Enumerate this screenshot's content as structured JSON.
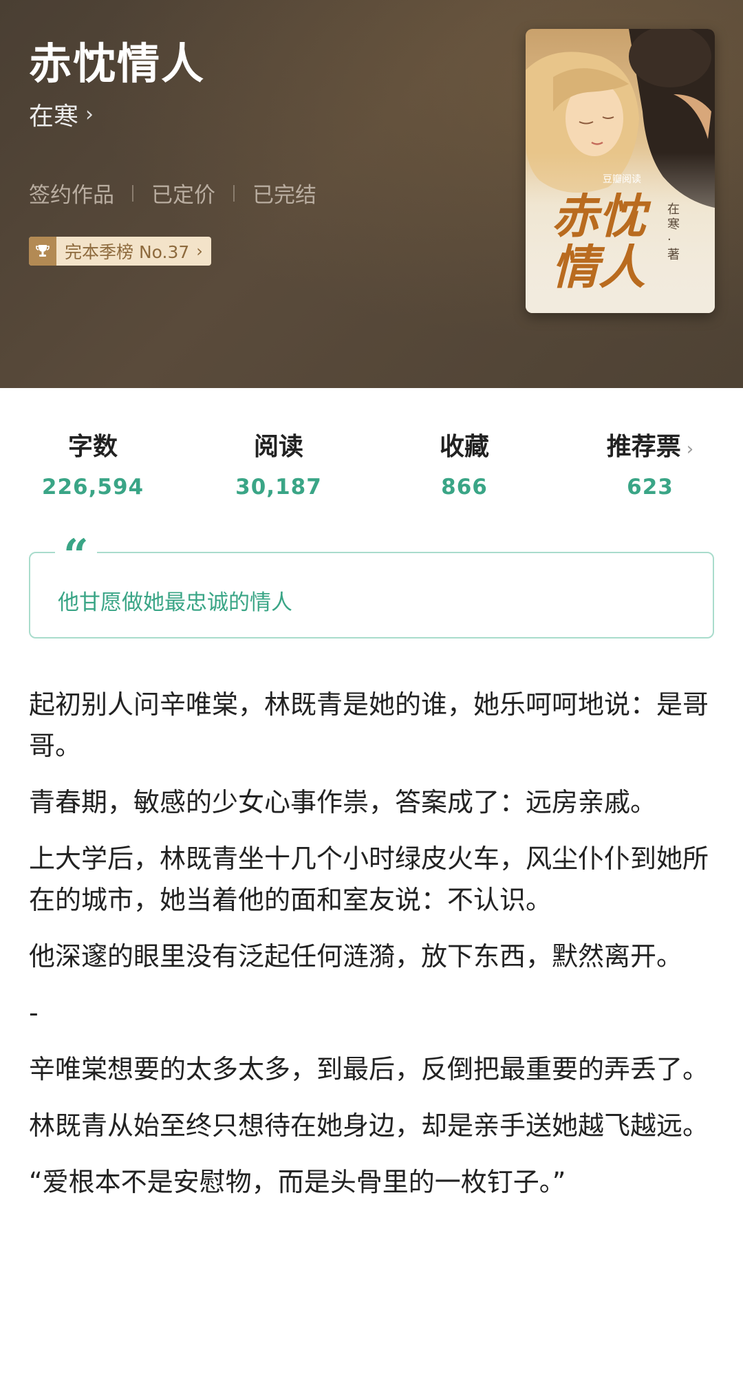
{
  "book": {
    "title": "赤忱情人",
    "author": "在寒",
    "tags": [
      "签约作品",
      "已定价",
      "已完结"
    ],
    "rank_badge": "完本季榜 No.37",
    "cover": {
      "publisher": "豆瓣阅读",
      "title": "赤忱情人",
      "author_credit": "在寒·著"
    }
  },
  "stats": [
    {
      "label": "字数",
      "value": "226,594"
    },
    {
      "label": "阅读",
      "value": "30,187"
    },
    {
      "label": "收藏",
      "value": "866"
    },
    {
      "label": "推荐票",
      "value": "623"
    }
  ],
  "quote": {
    "mark": "“",
    "text": "他甘愿做她最忠诚的情人"
  },
  "synopsis": [
    "起初别人问辛唯棠，林既青是她的谁，她乐呵呵地说：是哥哥。",
    "青春期，敏感的少女心事作祟，答案成了：远房亲戚。",
    "上大学后，林既青坐十几个小时绿皮火车，风尘仆仆到她所在的城市，她当着他的面和室友说：不认识。",
    "他深邃的眼里没有泛起任何涟漪，放下东西，默然离开。",
    "-",
    "辛唯棠想要的太多太多，到最后，反倒把最重要的弄丢了。",
    "林既青从始至终只想待在她身边，却是亲手送她越飞越远。",
    "“爱根本不是安慰物，而是头骨里的一枚钉子。”"
  ],
  "icons": {
    "author_chevron": "chevron-right-icon",
    "trophy": "trophy-icon",
    "badge_chevron": "chevron-right-icon",
    "stat_chevron": "chevron-right-icon",
    "quote": "quote-mark-icon"
  },
  "colors": {
    "accent": "#3aa586",
    "header_bg": "#4f4335",
    "badge_bg": "#f3e3c9",
    "badge_text": "#8d6a3d",
    "cover_title": "#b96b1f"
  }
}
